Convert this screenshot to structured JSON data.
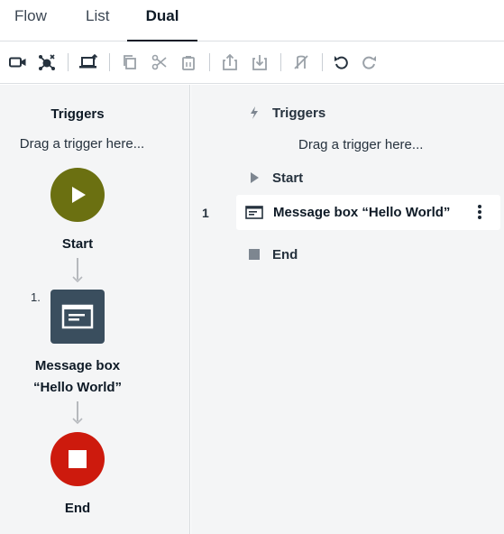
{
  "tabs": [
    {
      "label": "Flow"
    },
    {
      "label": "List"
    },
    {
      "label": "Dual",
      "active": true
    }
  ],
  "toolbar": {
    "icons": [
      "video-record-icon",
      "bot-connect-icon",
      "laptop-upload-icon",
      "copy-icon",
      "cut-icon",
      "paste-icon",
      "extract-icon",
      "insert-icon",
      "disable-icon",
      "undo-icon",
      "redo-icon"
    ]
  },
  "left_panel": {
    "triggers_title": "Triggers",
    "drag_hint": "Drag a trigger here...",
    "start_label": "Start",
    "step_number": "1.",
    "message_box_label": "Message box",
    "message_box_value": "“Hello World”",
    "end_label": "End",
    "colors": {
      "start": "#6b7011",
      "message": "#3a4e5e",
      "end": "#cd1a0d"
    }
  },
  "right_panel": {
    "triggers_label": "Triggers",
    "drag_hint": "Drag a trigger here...",
    "start_label": "Start",
    "line_number": "1",
    "message_row_text": "Message box “Hello World”",
    "end_label": "End"
  }
}
